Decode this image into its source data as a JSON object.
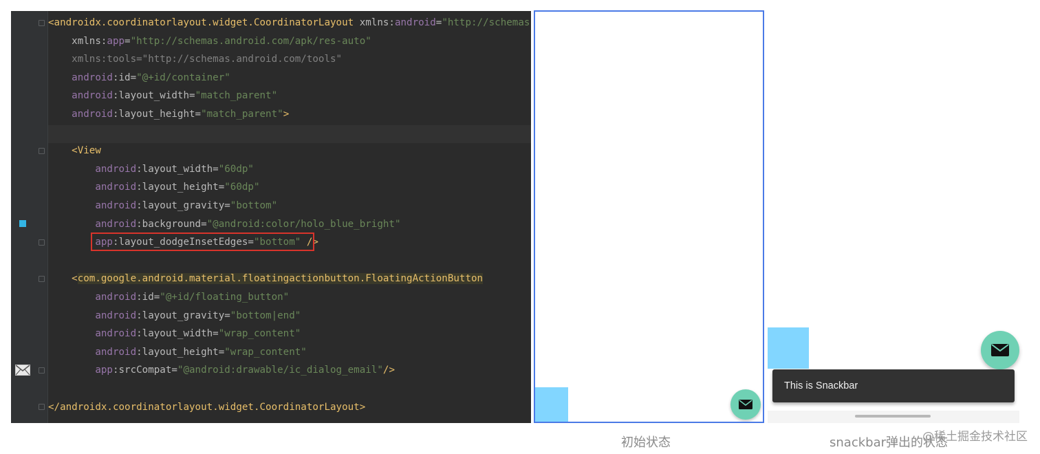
{
  "code_editor": {
    "lines": [
      {
        "parts": [
          {
            "c": "tag",
            "t": "<androidx.coordinatorlayout.widget.CoordinatorLayout "
          },
          {
            "c": "attr",
            "t": "xmlns:"
          },
          {
            "c": "ns",
            "t": "android"
          },
          {
            "c": "attr",
            "t": "="
          },
          {
            "c": "val",
            "t": "\"http://schemas.android.com/apk/res/android\""
          }
        ]
      },
      {
        "parts": [
          {
            "c": "attr",
            "t": "    xmlns:"
          },
          {
            "c": "ns",
            "t": "app"
          },
          {
            "c": "attr",
            "t": "="
          },
          {
            "c": "val",
            "t": "\"http://schemas.android.com/apk/res-auto\""
          }
        ]
      },
      {
        "parts": [
          {
            "c": "dim",
            "t": "    xmlns:tools=\"http://schemas.android.com/tools\""
          }
        ]
      },
      {
        "parts": [
          {
            "c": "ns",
            "t": "    android"
          },
          {
            "c": "attr",
            "t": ":id="
          },
          {
            "c": "val",
            "t": "\"@+id/container\""
          }
        ]
      },
      {
        "parts": [
          {
            "c": "ns",
            "t": "    android"
          },
          {
            "c": "attr",
            "t": ":layout_width="
          },
          {
            "c": "val",
            "t": "\"match_parent\""
          }
        ]
      },
      {
        "parts": [
          {
            "c": "ns",
            "t": "    android"
          },
          {
            "c": "attr",
            "t": ":layout_height="
          },
          {
            "c": "val",
            "t": "\"match_parent\""
          },
          {
            "c": "tag",
            "t": ">"
          }
        ]
      },
      {
        "parts": [
          {
            "c": "attr",
            "t": ""
          }
        ]
      },
      {
        "parts": [
          {
            "c": "tag",
            "t": "    <View"
          }
        ]
      },
      {
        "parts": [
          {
            "c": "ns",
            "t": "        android"
          },
          {
            "c": "attr",
            "t": ":layout_width="
          },
          {
            "c": "val",
            "t": "\"60dp\""
          }
        ]
      },
      {
        "parts": [
          {
            "c": "ns",
            "t": "        android"
          },
          {
            "c": "attr",
            "t": ":layout_height="
          },
          {
            "c": "val",
            "t": "\"60dp\""
          }
        ]
      },
      {
        "parts": [
          {
            "c": "ns",
            "t": "        android"
          },
          {
            "c": "attr",
            "t": ":layout_gravity="
          },
          {
            "c": "val",
            "t": "\"bottom\""
          }
        ]
      },
      {
        "parts": [
          {
            "c": "ns",
            "t": "        android"
          },
          {
            "c": "attr",
            "t": ":background="
          },
          {
            "c": "val",
            "t": "\"@android:color/holo_blue_bright\""
          }
        ]
      },
      {
        "parts": [
          {
            "c": "ns",
            "t": "        app"
          },
          {
            "c": "attr",
            "t": ":layout_dodgeInsetEdges="
          },
          {
            "c": "val",
            "t": "\"bottom\""
          },
          {
            "c": "tag",
            "t": " />"
          }
        ]
      },
      {
        "parts": [
          {
            "c": "attr",
            "t": ""
          }
        ]
      },
      {
        "parts": [
          {
            "c": "tag",
            "t": "    <"
          },
          {
            "c": "tag hl",
            "t": "com.google.android.material.floatingactionbutton.FloatingActionButton"
          }
        ]
      },
      {
        "parts": [
          {
            "c": "ns",
            "t": "        android"
          },
          {
            "c": "attr",
            "t": ":id="
          },
          {
            "c": "val",
            "t": "\"@+id/floating_button\""
          }
        ]
      },
      {
        "parts": [
          {
            "c": "ns",
            "t": "        android"
          },
          {
            "c": "attr",
            "t": ":layout_gravity="
          },
          {
            "c": "val",
            "t": "\"bottom|end\""
          }
        ]
      },
      {
        "parts": [
          {
            "c": "ns",
            "t": "        android"
          },
          {
            "c": "attr",
            "t": ":layout_width="
          },
          {
            "c": "val",
            "t": "\"wrap_content\""
          }
        ]
      },
      {
        "parts": [
          {
            "c": "ns",
            "t": "        android"
          },
          {
            "c": "attr",
            "t": ":layout_height="
          },
          {
            "c": "val",
            "t": "\"wrap_content\""
          }
        ]
      },
      {
        "parts": [
          {
            "c": "ns",
            "t": "        app"
          },
          {
            "c": "attr",
            "t": ":srcCompat="
          },
          {
            "c": "val",
            "t": "\"@android:drawable/ic_dialog_email\""
          },
          {
            "c": "tag",
            "t": "/>"
          }
        ]
      },
      {
        "parts": [
          {
            "c": "attr",
            "t": ""
          }
        ]
      },
      {
        "parts": [
          {
            "c": "tag",
            "t": "</androidx.coordinatorlayout.widget.CoordinatorLayout>"
          }
        ]
      }
    ],
    "highlighted_attribute": "app:layout_dodgeInsetEdges=\"bottom\""
  },
  "colors": {
    "view_color": "#82d6ff",
    "fab_color": "#6fd1b4",
    "highlight_box": "#d9342b",
    "frame_border": "#4a7ae6"
  },
  "phone_snackbar": {
    "snackbar_text": "This is Snackbar"
  },
  "icons": [
    "mail-icon",
    "fold-marker-icon",
    "color-swatch-icon"
  ],
  "captions": {
    "initial": "初始状态",
    "snackbar": "snackbar弹出的状态"
  },
  "watermark": "@稀土掘金技术社区"
}
